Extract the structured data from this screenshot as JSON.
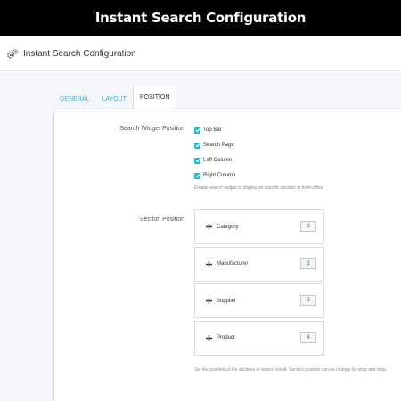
{
  "banner": {
    "title": "Instant Search Configuration"
  },
  "panel": {
    "title": "Instant Search Configuration",
    "icon": "gears-icon"
  },
  "tabs": [
    {
      "label": "GENERAL",
      "active": false
    },
    {
      "label": "LAYOUT",
      "active": false
    },
    {
      "label": "POSITION",
      "active": true
    }
  ],
  "search_widget": {
    "label": "Search Widget Position",
    "options": [
      {
        "label": "Top Bar",
        "checked": true
      },
      {
        "label": "Search Page",
        "checked": true
      },
      {
        "label": "Left Column",
        "checked": true
      },
      {
        "label": "Right Column",
        "checked": true
      }
    ],
    "help": "Enable search widget to display on specific position in front-office."
  },
  "section_position": {
    "label": "Section Position",
    "items": [
      {
        "name": "Category",
        "position": "1"
      },
      {
        "name": "Manufacturer",
        "position": "2"
      },
      {
        "name": "Supplier",
        "position": "3"
      },
      {
        "name": "Product",
        "position": "4"
      }
    ],
    "help": "Set the position of the sections in search result. Section position can be change by drag and drop."
  },
  "colors": {
    "accent": "#25b9d7",
    "banner_bg": "#000000",
    "page_bg": "#f4f6f9"
  }
}
